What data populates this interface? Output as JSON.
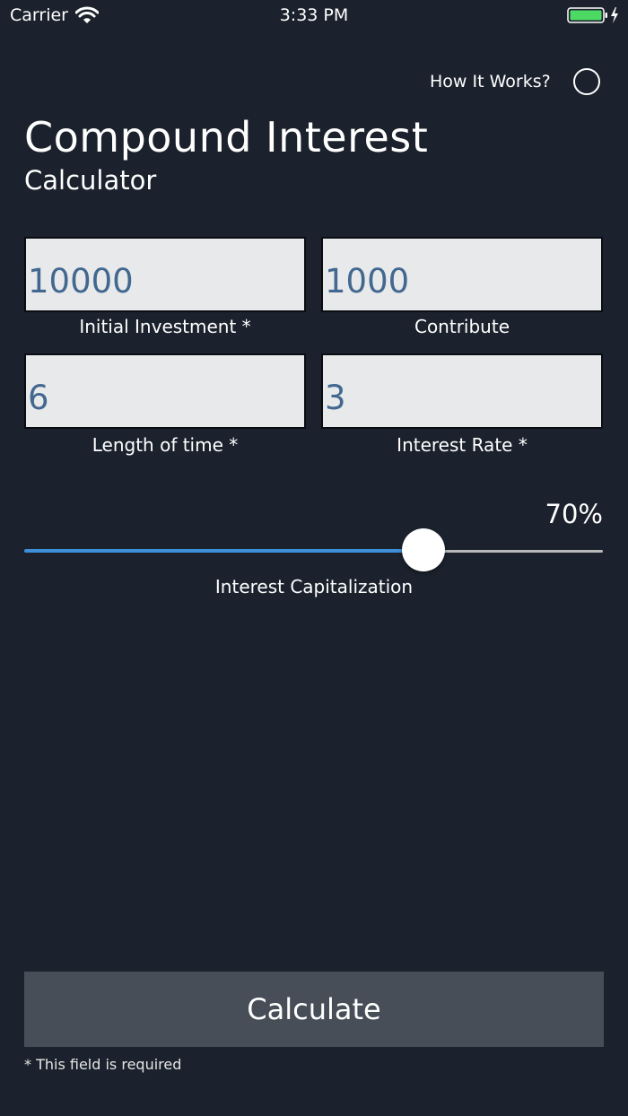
{
  "status_bar": {
    "carrier": "Carrier",
    "time": "3:33 PM",
    "battery_color": "#4cd964"
  },
  "header": {
    "how_it_works_label": "How It Works?",
    "title": "Compound Interest",
    "subtitle": "Calculator"
  },
  "form": {
    "fields": [
      {
        "label": "Initial Investment *",
        "value": "10000"
      },
      {
        "label": "Contribute",
        "value": "1000"
      },
      {
        "label": "Length of time *",
        "value": "6"
      },
      {
        "label": "Interest Rate *",
        "value": "3"
      }
    ],
    "slider": {
      "label": "Interest Capitalization",
      "value_text": "70%",
      "value_percent": 70,
      "fill_color": "#3f8fd8"
    }
  },
  "actions": {
    "calculate_label": "Calculate",
    "required_note": "* This field is required"
  },
  "colors": {
    "background": "#1b222d",
    "field_text": "#43688f",
    "button_bg": "#474e58"
  }
}
